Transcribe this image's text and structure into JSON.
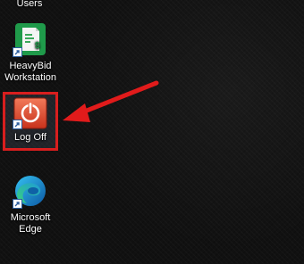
{
  "desktop": {
    "icons": [
      {
        "label": "Users",
        "icon": "users-folder-icon"
      },
      {
        "label": "HeavyBid Workstation",
        "icon": "heavybid-document-icon"
      },
      {
        "label": "Log Off",
        "icon": "power-icon"
      },
      {
        "label": "Microsoft Edge",
        "icon": "edge-browser-icon"
      }
    ],
    "highlight_color": "#d81e1e",
    "annotation_arrow_color": "#e11b1b"
  }
}
